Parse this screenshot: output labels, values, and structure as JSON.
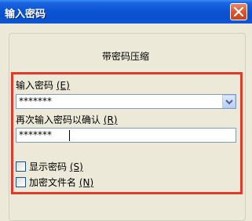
{
  "window": {
    "title": "输入密码"
  },
  "dialog": {
    "heading": "带密码压缩",
    "password_label": "输入密码",
    "password_accel": "(E)",
    "password_value": "*******",
    "confirm_label": "再次输入密码以确认",
    "confirm_accel": "(R)",
    "confirm_value": "*******",
    "show_password_label": "显示密码",
    "show_password_accel": "(S)",
    "show_password_checked": false,
    "encrypt_names_label": "加密文件名",
    "encrypt_names_accel": "(N)",
    "encrypt_names_checked": false
  },
  "colors": {
    "titlebar": "#0c54d5",
    "highlight_border": "#e03a2a",
    "dialog_bg": "#ece9d8",
    "close_button": "#d9532b"
  },
  "icons": {
    "close": "close-icon",
    "dropdown": "chevron-down-icon"
  }
}
